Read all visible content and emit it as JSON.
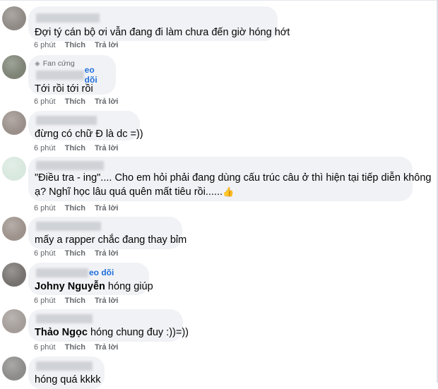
{
  "comments": [
    {
      "text": "Đợi tý cán bộ ơi vẫn đang đi làm chưa đến giờ hóng hớt",
      "time": "6 phút",
      "like": "Thích",
      "reply": "Trả lời"
    },
    {
      "badge": "Fan cứng",
      "follow": "eo dõi",
      "text": "Tới rồi tới rồi",
      "time": "6 phút",
      "like": "Thích",
      "reply": "Trả lời"
    },
    {
      "text": "đừng có chữ Đ là dc =))",
      "time": "6 phút",
      "like": "Thích",
      "reply": "Trả lời"
    },
    {
      "text_line1": "\"Điều tra - ing\".... Cho em hỏi phải đang dùng cấu trúc câu ở thì hiện tại tiếp diễn không",
      "text_line2": "ạ? Nghĩ học lâu quá quên mất tiêu rồi......",
      "emoji": "👍",
      "time": "6 phút",
      "like": "Thích",
      "reply": "Trả lời"
    },
    {
      "text": "mấy a rapper chắc đang thay bỉm",
      "time": "6 phút",
      "like": "Thích",
      "reply": "Trả lời"
    },
    {
      "follow": "eo dõi",
      "mention": "Johny Nguyễn",
      "text": " hóng giúp",
      "time": "6 phút",
      "like": "Thích",
      "reply": "Trả lời"
    },
    {
      "mention": "Thảo Ngọc",
      "text": " hóng chung đuy :))=))",
      "time": "6 phút",
      "like": "Thích",
      "reply": "Trả lời"
    },
    {
      "text": "hóng quá kkkk"
    }
  ],
  "colors": {
    "bubble": "#f0f2f5",
    "link": "#216fdb",
    "meta": "#65676b"
  }
}
